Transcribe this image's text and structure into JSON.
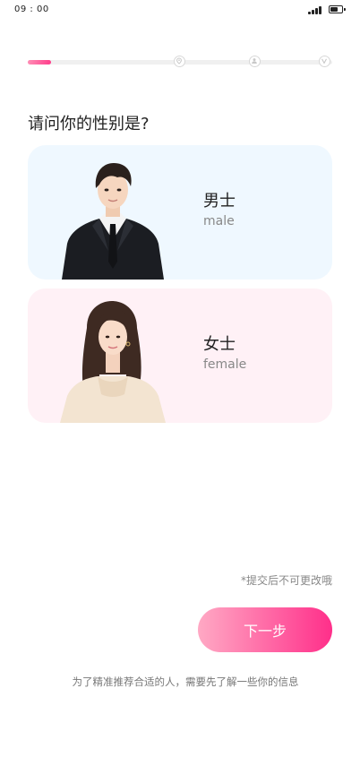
{
  "status_bar": {
    "time": "09 : 00"
  },
  "progress": {
    "current_step": 1,
    "total_steps": 4,
    "fraction": 0.08,
    "step_icons": [
      "location-icon",
      "person-icon",
      "vip-icon"
    ],
    "accent_color": "#ff3d8b"
  },
  "question": "请问你的性别是?",
  "options": {
    "male": {
      "label_zh": "男士",
      "label_en": "male",
      "background": "#eff8ff"
    },
    "female": {
      "label_zh": "女士",
      "label_en": "female",
      "background": "#fff1f6"
    }
  },
  "notice": "*提交后不可更改哦",
  "next_button": {
    "label": "下一步"
  },
  "info_text": "为了精准推荐合适的人，需要先了解一些你的信息"
}
